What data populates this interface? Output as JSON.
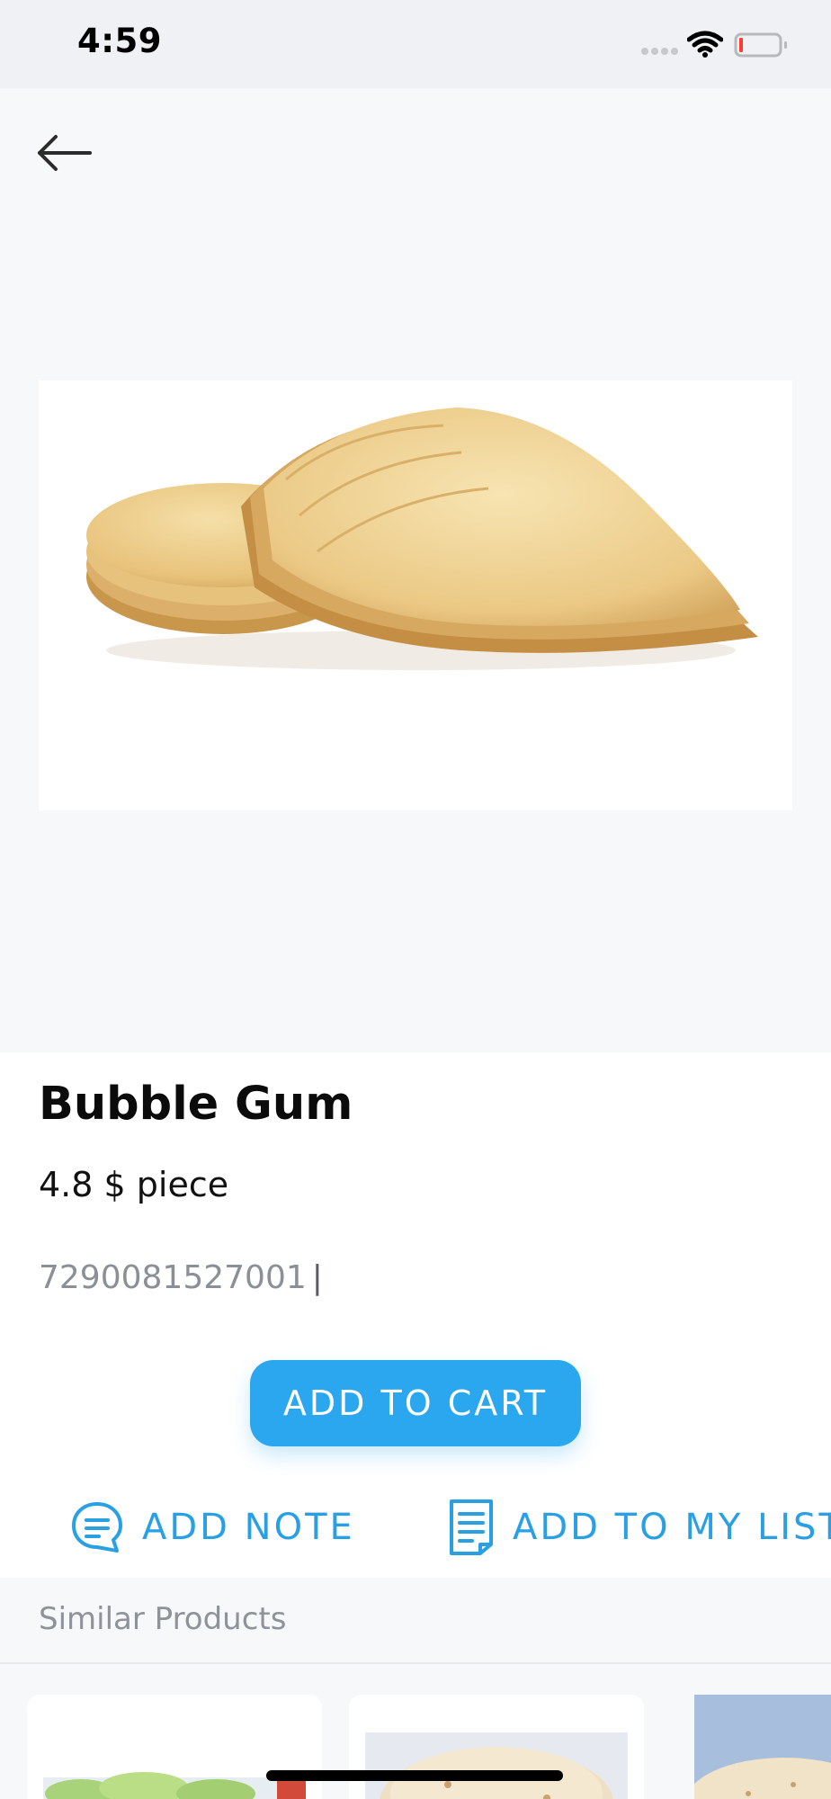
{
  "status_bar": {
    "time": "4:59"
  },
  "product": {
    "name": "Bubble Gum",
    "price": "4.8 $ piece",
    "barcode": "7290081527001",
    "image_alt": "tortilla-stack"
  },
  "actions": {
    "add_to_cart": "ADD TO CART",
    "add_note": "ADD NOTE",
    "add_to_my_list": "ADD TO MY LIST"
  },
  "similar": {
    "title": "Similar Products"
  },
  "colors": {
    "accent": "#2aa7ee",
    "status_bg": "#eff1f5",
    "hero_bg": "#f7f8fa"
  },
  "icons": {
    "back": "arrow-left-icon",
    "note": "chat-bubble-icon",
    "list": "document-list-icon",
    "signal": "signal-dots-icon",
    "wifi": "wifi-icon",
    "battery": "battery-low-icon"
  }
}
